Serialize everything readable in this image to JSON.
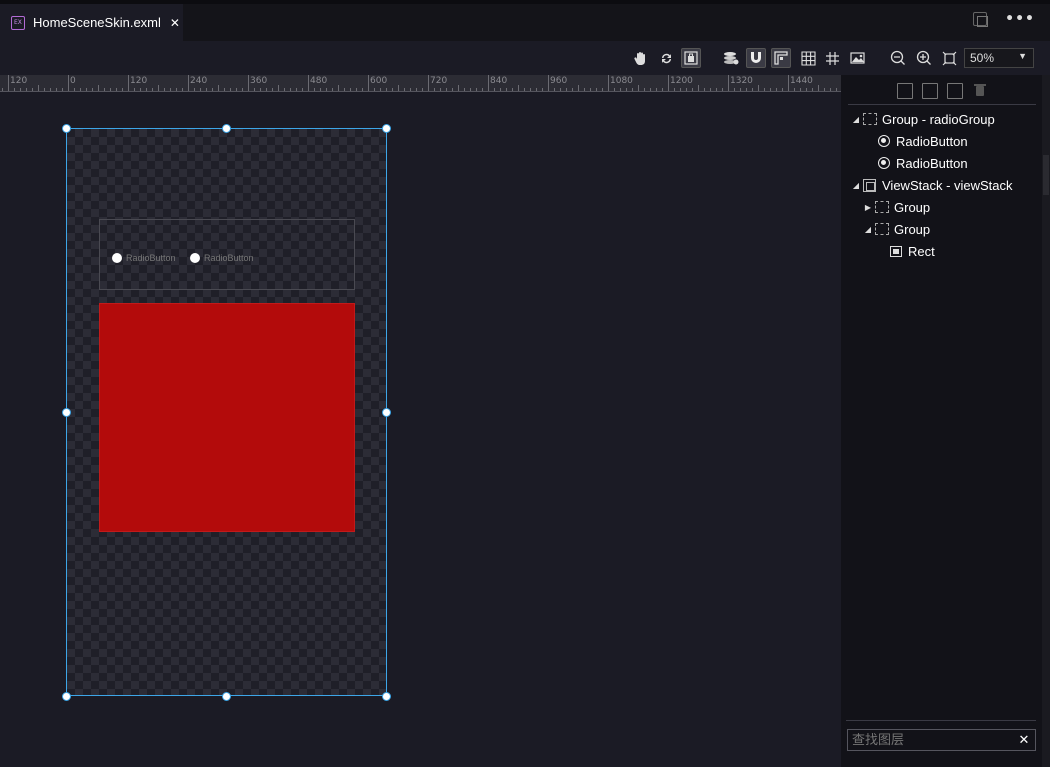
{
  "tab": {
    "title": "HomeSceneSkin.exml",
    "close": "✕"
  },
  "tabbar": {
    "more": "•••"
  },
  "toolbar": {
    "zoom_value": "50%",
    "zoom_arrow": "▼",
    "icons": [
      "hand-icon",
      "refresh-icon",
      "fit-icon",
      "layers-icon",
      "magnet-icon",
      "guide-icon",
      "grid-icon",
      "hash-grid-icon",
      "image-icon",
      "zoom-out-icon",
      "zoom-in-icon",
      "fullscreen-icon"
    ]
  },
  "ruler": {
    "labels": [
      "120",
      "0",
      "120",
      "240",
      "360",
      "480",
      "600",
      "720",
      "840",
      "960",
      "1080",
      "1200",
      "1320",
      "1440"
    ]
  },
  "canvas": {
    "radio_1": "RadioButton",
    "radio_2": "RadioButton",
    "rect_color": "#b30b0b",
    "selection_color": "#3da6e8"
  },
  "layers": {
    "rows": [
      {
        "label": "Group - radioGroup",
        "caret": "◢",
        "icon": "group-icon"
      },
      {
        "label": "RadioButton",
        "caret": "",
        "icon": "radio-icon"
      },
      {
        "label": "RadioButton",
        "caret": "",
        "icon": "radio-icon"
      },
      {
        "label": "ViewStack - viewStack",
        "caret": "◢",
        "icon": "viewstack-icon"
      },
      {
        "label": "Group",
        "caret": "▶",
        "icon": "group-icon"
      },
      {
        "label": "Group",
        "caret": "◢",
        "icon": "group-icon"
      },
      {
        "label": "Rect",
        "caret": "",
        "icon": "rect-icon"
      }
    ],
    "search_placeholder": "查找图层",
    "search_clear": "✕"
  }
}
